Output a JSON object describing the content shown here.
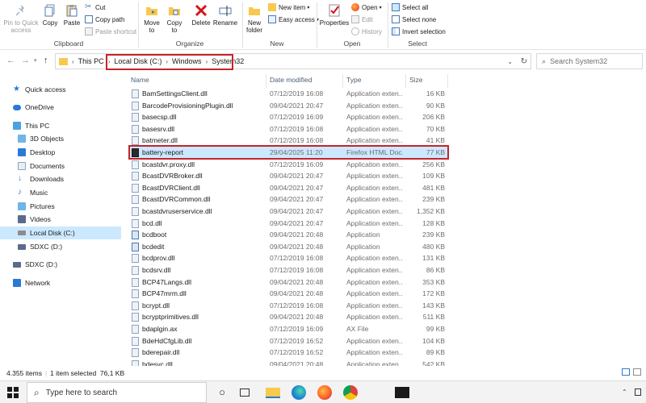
{
  "ribbon": {
    "clipboard": {
      "pin_label": "Pin to Quick access",
      "pin_line1": "Pin to Quick",
      "pin_line2": "access",
      "copy": "Copy",
      "paste": "Paste",
      "cut": "Cut",
      "copy_path": "Copy path",
      "paste_shortcut": "Paste shortcut",
      "group": "Clipboard"
    },
    "organize": {
      "move_to_1": "Move",
      "move_to_2": "to",
      "copy_to_1": "Copy",
      "copy_to_2": "to",
      "delete": "Delete",
      "rename": "Rename",
      "group": "Organize"
    },
    "new": {
      "new_folder_1": "New",
      "new_folder_2": "folder",
      "new_item": "New item",
      "easy_access": "Easy access",
      "group": "New"
    },
    "open": {
      "properties": "Properties",
      "open": "Open",
      "edit": "Edit",
      "history": "History",
      "group": "Open"
    },
    "select": {
      "select_all": "Select all",
      "select_none": "Select none",
      "invert": "Invert selection",
      "group": "Select"
    }
  },
  "address": {
    "crumbs": [
      "This PC",
      "Local Disk (C:)",
      "Windows",
      "System32"
    ],
    "search_placeholder": "Search System32"
  },
  "nav": {
    "quick_access": "Quick access",
    "onedrive": "OneDrive",
    "this_pc": "This PC",
    "objects3d": "3D Objects",
    "desktop": "Desktop",
    "documents": "Documents",
    "downloads": "Downloads",
    "music": "Music",
    "pictures": "Pictures",
    "videos": "Videos",
    "local_disk": "Local Disk (C:)",
    "sdxc1": "SDXC (D:)",
    "sdxc2": "SDXC (D:)",
    "network": "Network"
  },
  "columns": {
    "name": "Name",
    "date": "Date modified",
    "type": "Type",
    "size": "Size"
  },
  "files": [
    {
      "name": "BamSettingsClient.dll",
      "date": "07/12/2019 16:08",
      "type": "Application exten...",
      "size": "16 KB"
    },
    {
      "name": "BarcodeProvisioningPlugin.dll",
      "date": "09/04/2021 20:47",
      "type": "Application exten...",
      "size": "90 KB"
    },
    {
      "name": "basecsp.dll",
      "date": "07/12/2019 16:09",
      "type": "Application exten...",
      "size": "206 KB"
    },
    {
      "name": "basesrv.dll",
      "date": "07/12/2019 16:08",
      "type": "Application exten...",
      "size": "70 KB"
    },
    {
      "name": "batmeter.dll",
      "date": "07/12/2019 16:08",
      "type": "Application exten...",
      "size": "41 KB"
    },
    {
      "name": "battery-report",
      "date": "29/04/2025 11:20",
      "type": "Firefox HTML Doc...",
      "size": "77 KB"
    },
    {
      "name": "bcastdvr.proxy.dll",
      "date": "07/12/2019 16:09",
      "type": "Application exten...",
      "size": "256 KB"
    },
    {
      "name": "BcastDVRBroker.dll",
      "date": "09/04/2021 20:47",
      "type": "Application exten...",
      "size": "109 KB"
    },
    {
      "name": "BcastDVRClient.dll",
      "date": "09/04/2021 20:47",
      "type": "Application exten...",
      "size": "481 KB"
    },
    {
      "name": "BcastDVRCommon.dll",
      "date": "09/04/2021 20:47",
      "type": "Application exten...",
      "size": "239 KB"
    },
    {
      "name": "bcastdvruserservice.dll",
      "date": "09/04/2021 20:47",
      "type": "Application exten...",
      "size": "1,352 KB"
    },
    {
      "name": "bcd.dll",
      "date": "09/04/2021 20:47",
      "type": "Application exten...",
      "size": "128 KB"
    },
    {
      "name": "bcdboot",
      "date": "09/04/2021 20:48",
      "type": "Application",
      "size": "239 KB"
    },
    {
      "name": "bcdedit",
      "date": "09/04/2021 20:48",
      "type": "Application",
      "size": "480 KB"
    },
    {
      "name": "bcdprov.dll",
      "date": "07/12/2019 16:08",
      "type": "Application exten...",
      "size": "131 KB"
    },
    {
      "name": "bcdsrv.dll",
      "date": "07/12/2019 16:08",
      "type": "Application exten...",
      "size": "86 KB"
    },
    {
      "name": "BCP47Langs.dll",
      "date": "09/04/2021 20:48",
      "type": "Application exten...",
      "size": "353 KB"
    },
    {
      "name": "BCP47mrm.dll",
      "date": "09/04/2021 20:48",
      "type": "Application exten...",
      "size": "172 KB"
    },
    {
      "name": "bcrypt.dll",
      "date": "07/12/2019 16:08",
      "type": "Application exten...",
      "size": "143 KB"
    },
    {
      "name": "bcryptprimitives.dll",
      "date": "09/04/2021 20:48",
      "type": "Application exten...",
      "size": "511 KB"
    },
    {
      "name": "bdaplgin.ax",
      "date": "07/12/2019 16:09",
      "type": "AX File",
      "size": "99 KB"
    },
    {
      "name": "BdeHdCfgLib.dll",
      "date": "07/12/2019 16:52",
      "type": "Application exten...",
      "size": "104 KB"
    },
    {
      "name": "bderepair.dll",
      "date": "07/12/2019 16:52",
      "type": "Application exten...",
      "size": "89 KB"
    },
    {
      "name": "bdesvc.dll",
      "date": "09/04/2021 20:48",
      "type": "Application exten...",
      "size": "542 KB"
    }
  ],
  "status": {
    "count": "4.355 items",
    "selected": "1 item selected  76,1 KB"
  },
  "taskbar": {
    "search_placeholder": "Type here to search"
  },
  "colors": {
    "accent": "#0078d7",
    "selection": "#cce8ff",
    "highlight_box": "#c5242b",
    "folder": "#f8c94d"
  }
}
